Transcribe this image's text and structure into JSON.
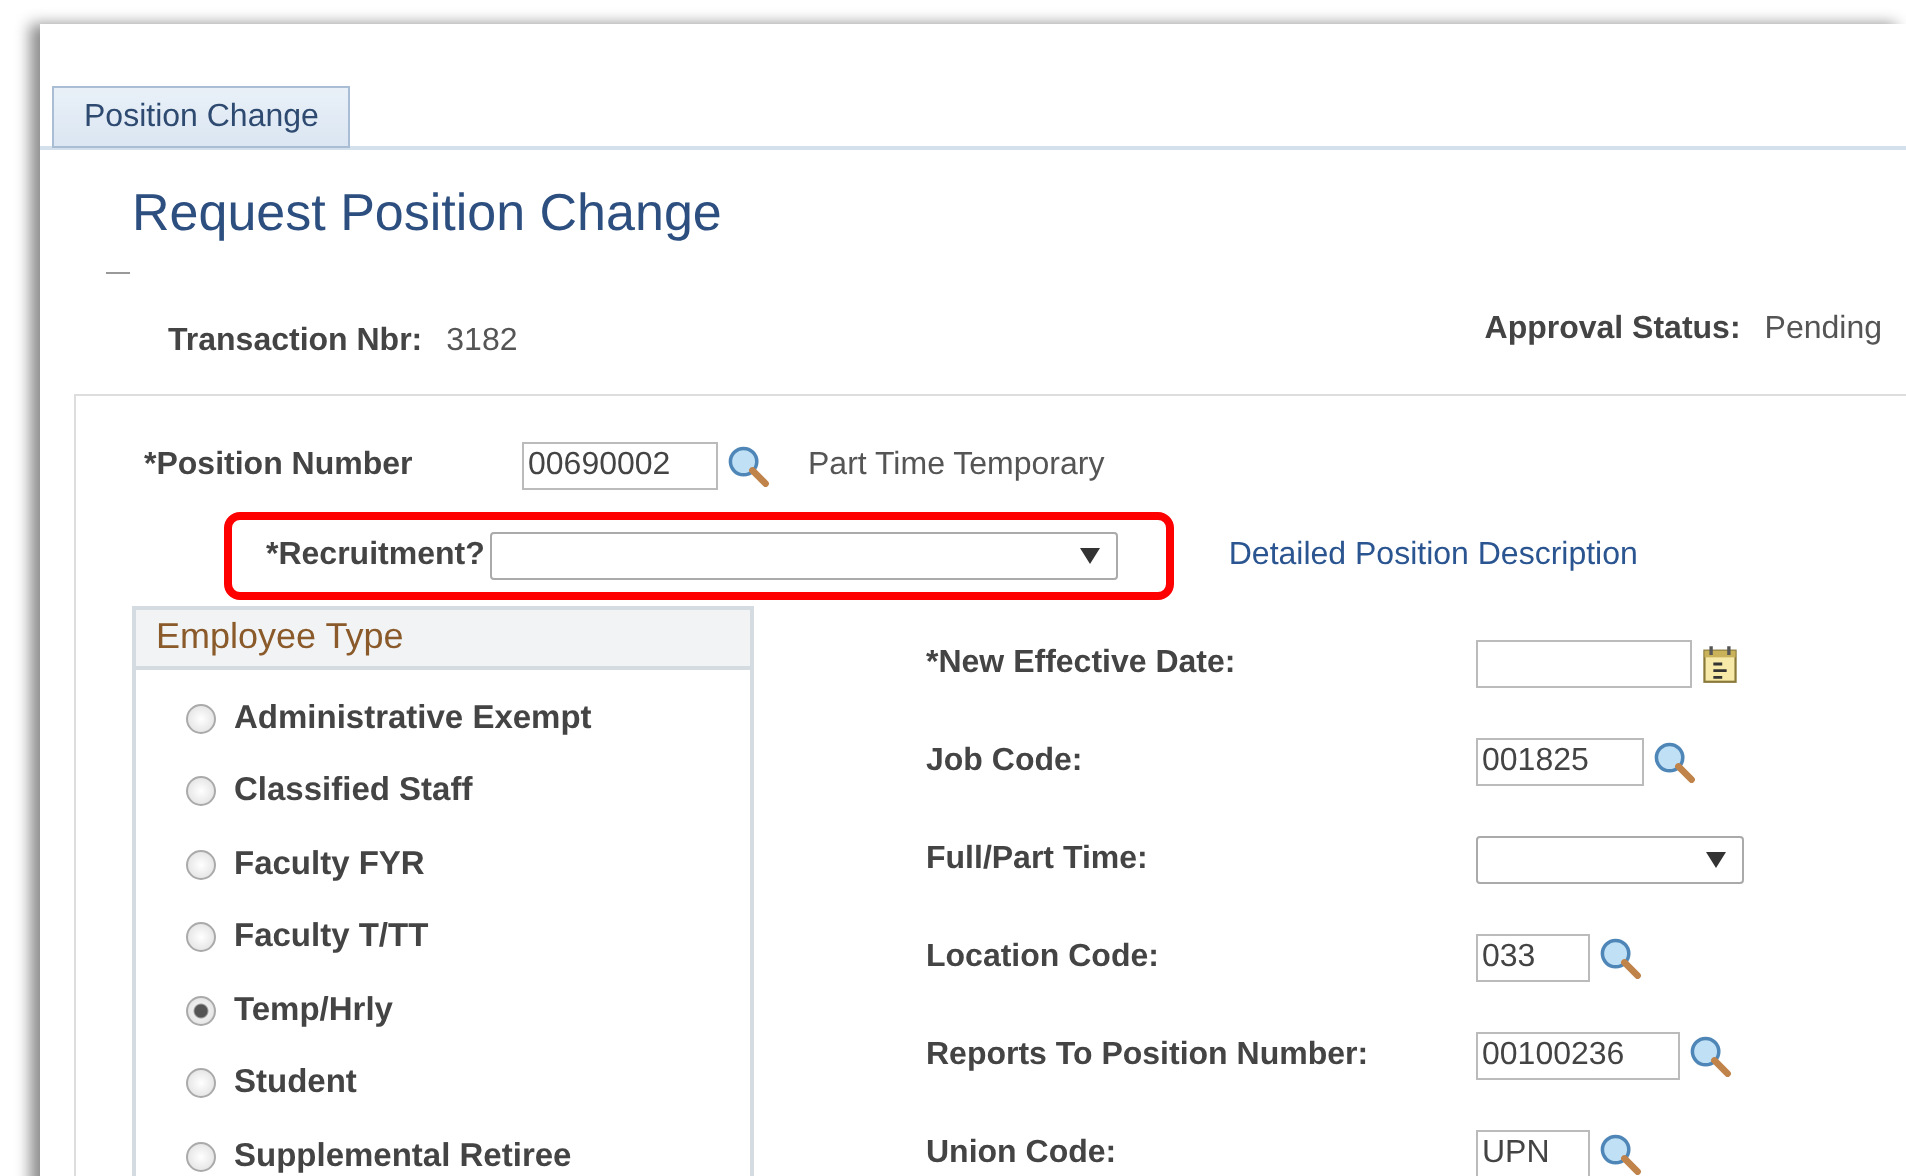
{
  "tabs": [
    {
      "label": "Position Change",
      "selected": true
    }
  ],
  "page_title": "Request Position Change",
  "header_fields": [
    {
      "label": "Transaction Nbr:",
      "value": "3182"
    },
    {
      "label": "Approval Status:",
      "value": "Pending"
    }
  ],
  "position": {
    "label": "*Position Number",
    "value": "00690002",
    "description": "Part Time Temporary"
  },
  "recruitment": {
    "label": "*Recruitment?",
    "highlighted": true
  },
  "link": "Detailed Position Description",
  "employee_type": {
    "title": "Employee Type",
    "options": [
      {
        "label": "Administrative Exempt",
        "selected": false
      },
      {
        "label": "Classified Staff",
        "selected": false
      },
      {
        "label": "Faculty FYR",
        "selected": false
      },
      {
        "label": "Faculty T/TT",
        "selected": false
      },
      {
        "label": "Temp/Hrly",
        "selected": true
      },
      {
        "label": "Student",
        "selected": false
      },
      {
        "label": "Supplemental Retiree",
        "selected": false
      }
    ]
  },
  "fields": [
    {
      "kind": "date",
      "label": "*New Effective Date:"
    },
    {
      "kind": "lookup",
      "label": "Job Code:",
      "value": "001825"
    },
    {
      "kind": "select",
      "label": "Full/Part Time:"
    },
    {
      "kind": "lookup",
      "label": "Location Code:",
      "value": "033"
    },
    {
      "kind": "lookup",
      "label": "Reports To Position Number:",
      "value": "00100236"
    },
    {
      "kind": "lookup",
      "label": "Union Code:",
      "value": "UPN"
    }
  ]
}
